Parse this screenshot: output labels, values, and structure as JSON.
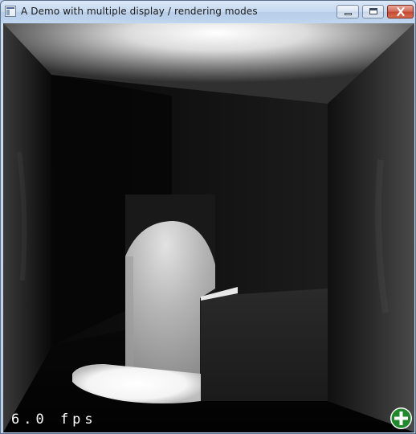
{
  "window": {
    "title": "A Demo with multiple display / rendering modes",
    "icon": "application-window-icon",
    "controls": {
      "minimize_icon": "minimize-icon",
      "maximize_icon": "maximize-icon",
      "close_icon": "close-icon",
      "close_color": "#c9452f"
    }
  },
  "viewport": {
    "fps_text": "6.0 fps",
    "add_button_icon": "plus-circle-icon",
    "add_button_color": "#1f8a2c"
  }
}
